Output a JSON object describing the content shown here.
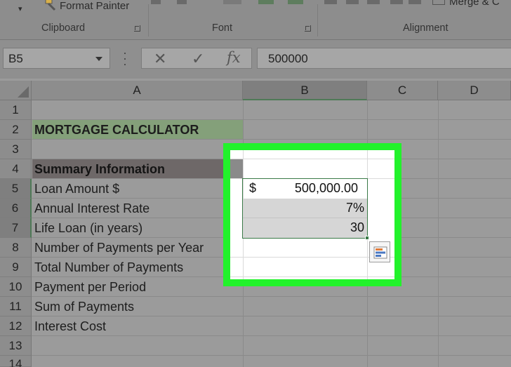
{
  "ribbon": {
    "format_painter_label": "Format Painter",
    "merge_label": "Merge & C",
    "groups": {
      "clipboard": "Clipboard",
      "font": "Font",
      "alignment": "Alignment"
    }
  },
  "formula_bar": {
    "name_box": "B5",
    "fx_symbol": "fx",
    "cancel_symbol": "✕",
    "enter_symbol": "✓",
    "value": "500000"
  },
  "columns": [
    "A",
    "B",
    "C",
    "D"
  ],
  "rows": [
    "1",
    "2",
    "3",
    "4",
    "5",
    "6",
    "7",
    "8",
    "9",
    "10",
    "11",
    "12",
    "13",
    "14"
  ],
  "cells": {
    "A2": "MORTGAGE CALCULATOR",
    "A4": "Summary Information",
    "A5": "Loan Amount $",
    "A6": "Annual Interest Rate",
    "A7": "Life Loan (in years)",
    "A8": "Number of Payments per Year",
    "A9": "Total Number of Payments",
    "A10": "Payment per Period",
    "A11": "Sum of Payments",
    "A12": "Interest Cost",
    "B5_currency": "$",
    "B5_value": "500,000.00",
    "B6": "7%",
    "B7": "30"
  },
  "colors": {
    "highlight": "#22f22b",
    "title_fill": "#84a07a",
    "selection": "#3a7a47"
  }
}
